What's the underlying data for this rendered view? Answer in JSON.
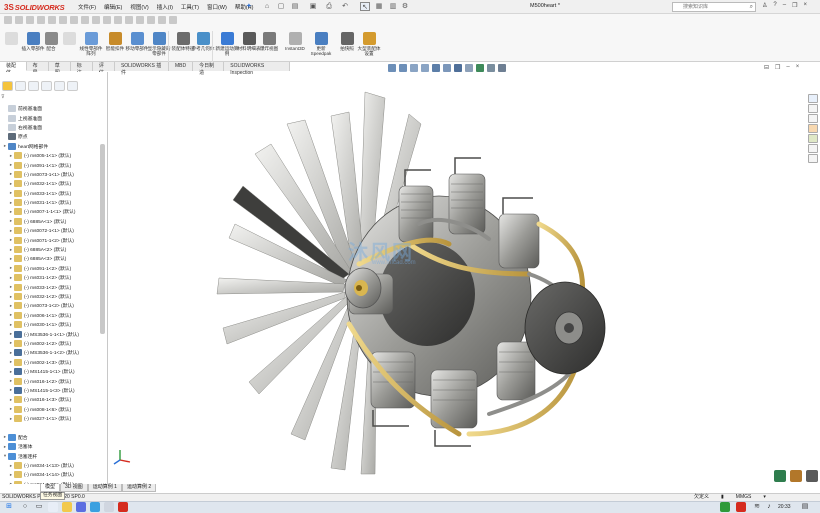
{
  "app": {
    "logo_prefix": "3S",
    "logo_text": "SOLIDWORKS",
    "document_title": "M500heart *"
  },
  "menu": [
    "文件(F)",
    "编辑(E)",
    "视图(V)",
    "插入(I)",
    "工具(T)",
    "窗口(W)",
    "帮助(H)"
  ],
  "search": {
    "placeholder": "搜索知识库"
  },
  "ribbon": [
    {
      "label": "插入零部件",
      "icon": "insert-component-icon",
      "color": "#4a7fc1",
      "disabled": false
    },
    {
      "label": "配合",
      "icon": "mate-icon",
      "color": "#8a8a8a",
      "disabled": false
    },
    {
      "label": "线性零部件阵列",
      "icon": "linear-pattern-icon",
      "color": "#6a9bd8",
      "disabled": false
    },
    {
      "label": "智能扣件",
      "icon": "smart-fastener-icon",
      "color": "#c78b2a",
      "disabled": false
    },
    {
      "label": "移动零部件",
      "icon": "move-component-icon",
      "color": "#5a8fd0",
      "disabled": false
    },
    {
      "label": "显示隐藏的零部件",
      "icon": "show-hidden-icon",
      "color": "#4f86c6",
      "disabled": false
    },
    {
      "label": "装配体特征",
      "icon": "assembly-feature-icon",
      "color": "#6c6c6c",
      "disabled": false
    },
    {
      "label": "参考几何体",
      "icon": "reference-geometry-icon",
      "color": "#4a90c9",
      "disabled": false
    },
    {
      "label": "新建运动算例",
      "icon": "motion-study-icon",
      "color": "#3a7bd5",
      "disabled": false
    },
    {
      "label": "材料明细表",
      "icon": "bom-icon",
      "color": "#5a5a5a",
      "disabled": false
    },
    {
      "label": "爆炸视图",
      "icon": "exploded-view-icon",
      "color": "#7a7a7a",
      "disabled": false
    },
    {
      "label": "Instant3D",
      "icon": "instant3d-icon",
      "color": "#b0b0b0",
      "disabled": false
    },
    {
      "label": "更新Speedpak",
      "icon": "speedpak-icon",
      "color": "#4a7fc1",
      "disabled": false
    },
    {
      "label": "拍快照",
      "icon": "snapshot-icon",
      "color": "#666666",
      "disabled": false
    },
    {
      "label": "大型装配体设置",
      "icon": "large-assembly-icon",
      "color": "#d49b2e",
      "disabled": false
    }
  ],
  "tabs": [
    "装配体",
    "布局",
    "草图",
    "标注",
    "评估",
    "SOLIDWORKS 插件",
    "MBD",
    "今日制造",
    "SOLIDWORKS Inspection"
  ],
  "tree": {
    "filter_icon": "filter-icon",
    "items": [
      {
        "label": "前视基准面",
        "type": "plane",
        "expand": ""
      },
      {
        "label": "上视基准面",
        "type": "plane",
        "expand": ""
      },
      {
        "label": "右视基准面",
        "type": "plane",
        "expand": ""
      },
      {
        "label": "原点",
        "type": "origin",
        "expand": ""
      },
      {
        "label": "heart网格部件",
        "type": "assembly",
        "expand": "▸"
      },
      {
        "label": "(-) ms005-1<1> (默认)",
        "type": "part",
        "expand": "▸"
      },
      {
        "label": "(-) ms091-1<1> (默认)",
        "type": "part",
        "expand": "▸"
      },
      {
        "label": "(-) ms0073-1<1> (默认)",
        "type": "part",
        "expand": "▸"
      },
      {
        "label": "(-) ms032-1<1> (默认)",
        "type": "part",
        "expand": "▸"
      },
      {
        "label": "(-) ms033-1<1> (默认)",
        "type": "part",
        "expand": "▸"
      },
      {
        "label": "(-) ms031-1<1> (默认)",
        "type": "part",
        "expand": "▸"
      },
      {
        "label": "(-) ms007-1-1<1> (默认)",
        "type": "part",
        "expand": "▸"
      },
      {
        "label": "(-) 6885A<1> (默认)",
        "type": "part",
        "expand": "▸"
      },
      {
        "label": "(-) ms0072-1<1> (默认)",
        "type": "part",
        "expand": "▸"
      },
      {
        "label": "(-) ms0071-1<2> (默认)",
        "type": "part",
        "expand": "▸"
      },
      {
        "label": "(-) 6885A<2> (默认)",
        "type": "part",
        "expand": "▸"
      },
      {
        "label": "(-) 6885A<3> (默认)",
        "type": "part",
        "expand": "▸"
      },
      {
        "label": "(-) ms091-1<2> (默认)",
        "type": "part",
        "expand": "▸"
      },
      {
        "label": "(-) ms031-1<2> (默认)",
        "type": "part",
        "expand": "▸"
      },
      {
        "label": "(-) ms033-1<2> (默认)",
        "type": "part",
        "expand": "▸"
      },
      {
        "label": "(-) ms032-1<2> (默认)",
        "type": "part",
        "expand": "▸"
      },
      {
        "label": "(-) ms0073-1<2> (默认)",
        "type": "part",
        "expand": "▸"
      },
      {
        "label": "(-) ms006-1<1> (默认)",
        "type": "part",
        "expand": "▸"
      },
      {
        "label": "(-) ms030-1<1> (默认)",
        "type": "part",
        "expand": "▸"
      },
      {
        "label": "(-) MS3536-1-1<1> (默认)",
        "type": "subasm",
        "expand": "▸"
      },
      {
        "label": "(-) ms002-1<2> (默认)",
        "type": "part",
        "expand": "▸"
      },
      {
        "label": "(-) MS3536-1-1<2> (默认)",
        "type": "subasm",
        "expand": "▸"
      },
      {
        "label": "(-) ms002-1<3> (默认)",
        "type": "part",
        "expand": "▸"
      },
      {
        "label": "(-) MS1415-1<1> (默认)",
        "type": "subasm",
        "expand": "▸"
      },
      {
        "label": "(-) ms016-1<2> (默认)",
        "type": "part",
        "expand": "▸"
      },
      {
        "label": "(-) MS1415-1<3> (默认)",
        "type": "subasm",
        "expand": "▸"
      },
      {
        "label": "(-) ms016-1<3> (默认)",
        "type": "part",
        "expand": "▸"
      },
      {
        "label": "(-) ms008-1<6> (默认)",
        "type": "part",
        "expand": "▸"
      },
      {
        "label": "(-) ms027-1<1> (默认)",
        "type": "part",
        "expand": "▸"
      },
      {
        "label": "",
        "type": "blank",
        "expand": ""
      },
      {
        "label": "配合",
        "type": "folder",
        "expand": "▸"
      },
      {
        "label": "活塞体",
        "type": "folder",
        "expand": "▸"
      },
      {
        "label": "活塞连杆",
        "type": "folder",
        "expand": "▾"
      },
      {
        "label": "(-) ms034-1<13> (默认)",
        "type": "part",
        "expand": "▸"
      },
      {
        "label": "(-) ms034-1<14> (默认)",
        "type": "part",
        "expand": "▸"
      },
      {
        "label": "(-) ms034-1<15> (默认)",
        "type": "part",
        "expand": "▸"
      }
    ]
  },
  "bottom_tabs": [
    "模型",
    "3D 视图",
    "运动算例 1",
    "运动算例 2"
  ],
  "tooltip": "任务视图",
  "status": {
    "left": "SOLIDWORKS Premium 2020 SP0.0",
    "custom": "欠定义",
    "units": "MMGS",
    "time": "20:33"
  },
  "watermark": {
    "text": "沐风网",
    "url": "www.mfcad.com"
  },
  "colors": {
    "accent": "#d52b1e",
    "selection_blue": "#2a6fd6",
    "folder_yellow": "#f4c33d"
  }
}
